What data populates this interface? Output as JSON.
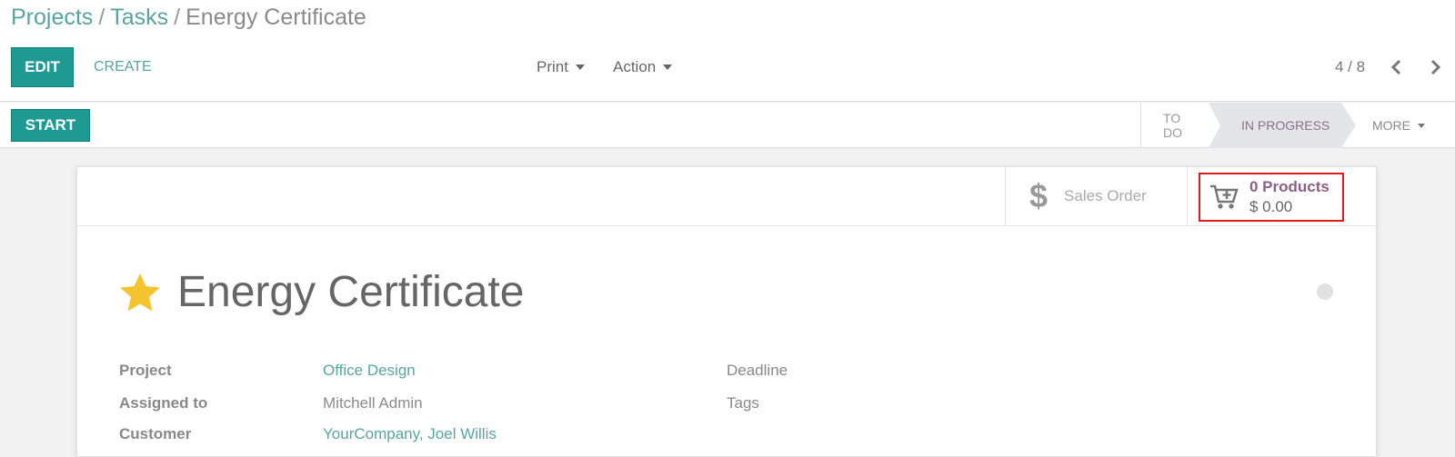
{
  "breadcrumb": {
    "project": "Projects",
    "tasks": "Tasks",
    "current": "Energy Certificate"
  },
  "toolbar": {
    "edit": "EDIT",
    "create": "CREATE",
    "print": "Print",
    "action": "Action"
  },
  "pager": {
    "value": "4 / 8"
  },
  "statusbar": {
    "start": "START",
    "stages": [
      "TO DO",
      "IN PROGRESS"
    ],
    "more": "MORE"
  },
  "smart_buttons": {
    "sales_order": "Sales Order",
    "products_count": "0 Products",
    "products_amount": "$ 0.00"
  },
  "task": {
    "title": "Energy Certificate",
    "fields": {
      "project_label": "Project",
      "project_value": "Office Design",
      "assigned_label": "Assigned to",
      "assigned_value": "Mitchell Admin",
      "customer_label": "Customer",
      "customer_value": "YourCompany, Joel Willis",
      "deadline_label": "Deadline",
      "tags_label": "Tags"
    }
  },
  "colors": {
    "primary": "#1e9a93",
    "link": "#5aa3a0",
    "highlight_border": "#e01b1b",
    "star": "#f4c430"
  }
}
